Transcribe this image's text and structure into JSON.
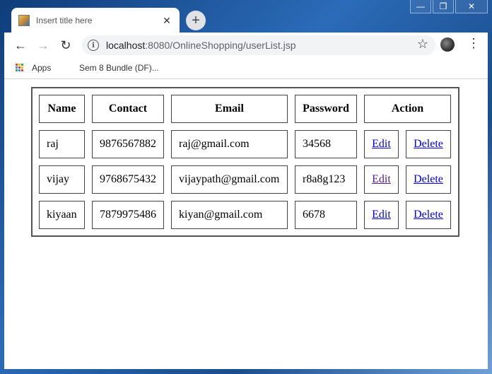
{
  "window": {
    "minimize": "—",
    "maximize": "❐",
    "close": "✕"
  },
  "tab": {
    "title": "Insert title here",
    "close": "✕"
  },
  "newtab": {
    "label": "+"
  },
  "toolbar": {
    "back": "←",
    "forward": "→",
    "reload": "↻",
    "info": "i",
    "url_host": "localhost",
    "url_rest": ":8080/OnlineShopping/userList.jsp",
    "star": "☆",
    "menu": "⋮"
  },
  "bookmarks": {
    "apps": "Apps",
    "item1": "Sem 8 Bundle (DF)..."
  },
  "table": {
    "headers": {
      "name": "Name",
      "contact": "Contact",
      "email": "Email",
      "password": "Password",
      "action": "Action"
    },
    "rows": [
      {
        "name": "raj",
        "contact": "9876567882",
        "email": "raj@gmail.com",
        "password": "34568",
        "edit": "Edit",
        "delete": "Delete"
      },
      {
        "name": "vijay",
        "contact": "9768675432",
        "email": "vijaypath@gmail.com",
        "password": "r8a8g123",
        "edit": "Edit",
        "delete": "Delete"
      },
      {
        "name": "kiyaan",
        "contact": "7879975486",
        "email": "kiyan@gmail.com",
        "password": "6678",
        "edit": "Edit",
        "delete": "Delete"
      }
    ]
  }
}
